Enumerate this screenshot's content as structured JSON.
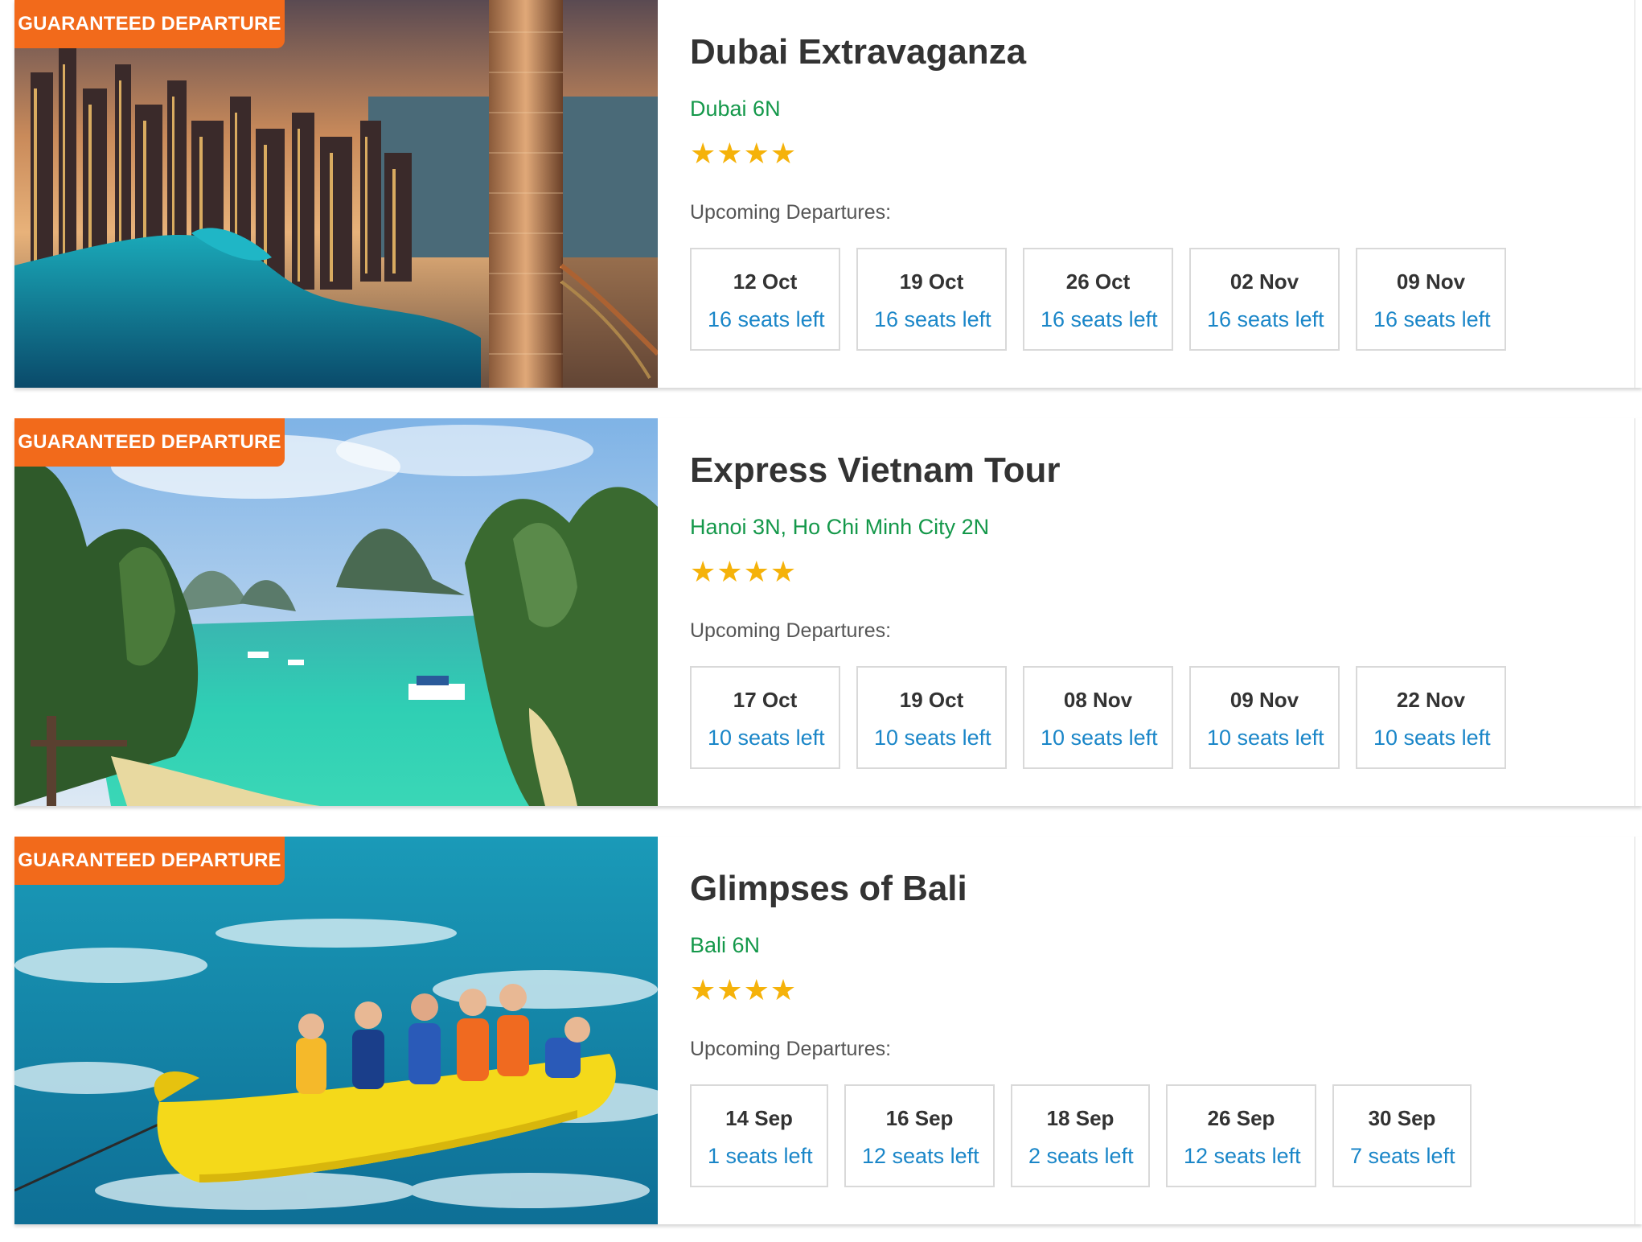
{
  "tours": [
    {
      "badge": "GUARANTEED DEPARTURE",
      "title": "Dubai Extravaganza",
      "destinations": "Dubai 6N",
      "rating": 4,
      "upcoming_label": "Upcoming Departures:",
      "departures": [
        {
          "date": "12 Oct",
          "seats": "16 seats left"
        },
        {
          "date": "19 Oct",
          "seats": "16 seats left"
        },
        {
          "date": "26 Oct",
          "seats": "16 seats left"
        },
        {
          "date": "02 Nov",
          "seats": "16 seats left"
        },
        {
          "date": "09 Nov",
          "seats": "16 seats left"
        }
      ]
    },
    {
      "badge": "GUARANTEED DEPARTURE",
      "title": "Express Vietnam Tour",
      "destinations": "Hanoi 3N, Ho Chi Minh City 2N",
      "rating": 4,
      "upcoming_label": "Upcoming Departures:",
      "departures": [
        {
          "date": "17 Oct",
          "seats": "10 seats left"
        },
        {
          "date": "19 Oct",
          "seats": "10 seats left"
        },
        {
          "date": "08 Nov",
          "seats": "10 seats left"
        },
        {
          "date": "09 Nov",
          "seats": "10 seats left"
        },
        {
          "date": "22 Nov",
          "seats": "10 seats left"
        }
      ]
    },
    {
      "badge": "GUARANTEED DEPARTURE",
      "title": "Glimpses of Bali",
      "destinations": "Bali 6N",
      "rating": 4,
      "upcoming_label": "Upcoming Departures:",
      "departures": [
        {
          "date": "14 Sep",
          "seats": "1 seats left"
        },
        {
          "date": "16 Sep",
          "seats": "12 seats left"
        },
        {
          "date": "18 Sep",
          "seats": "2 seats left"
        },
        {
          "date": "26 Sep",
          "seats": "12 seats left"
        },
        {
          "date": "30 Sep",
          "seats": "7 seats left"
        }
      ]
    }
  ],
  "icons": {
    "star": "star-icon"
  },
  "colors": {
    "badge": "#f26a1b",
    "destination": "#14984a",
    "seats": "#1a86c8",
    "star": "#f5b20a"
  }
}
